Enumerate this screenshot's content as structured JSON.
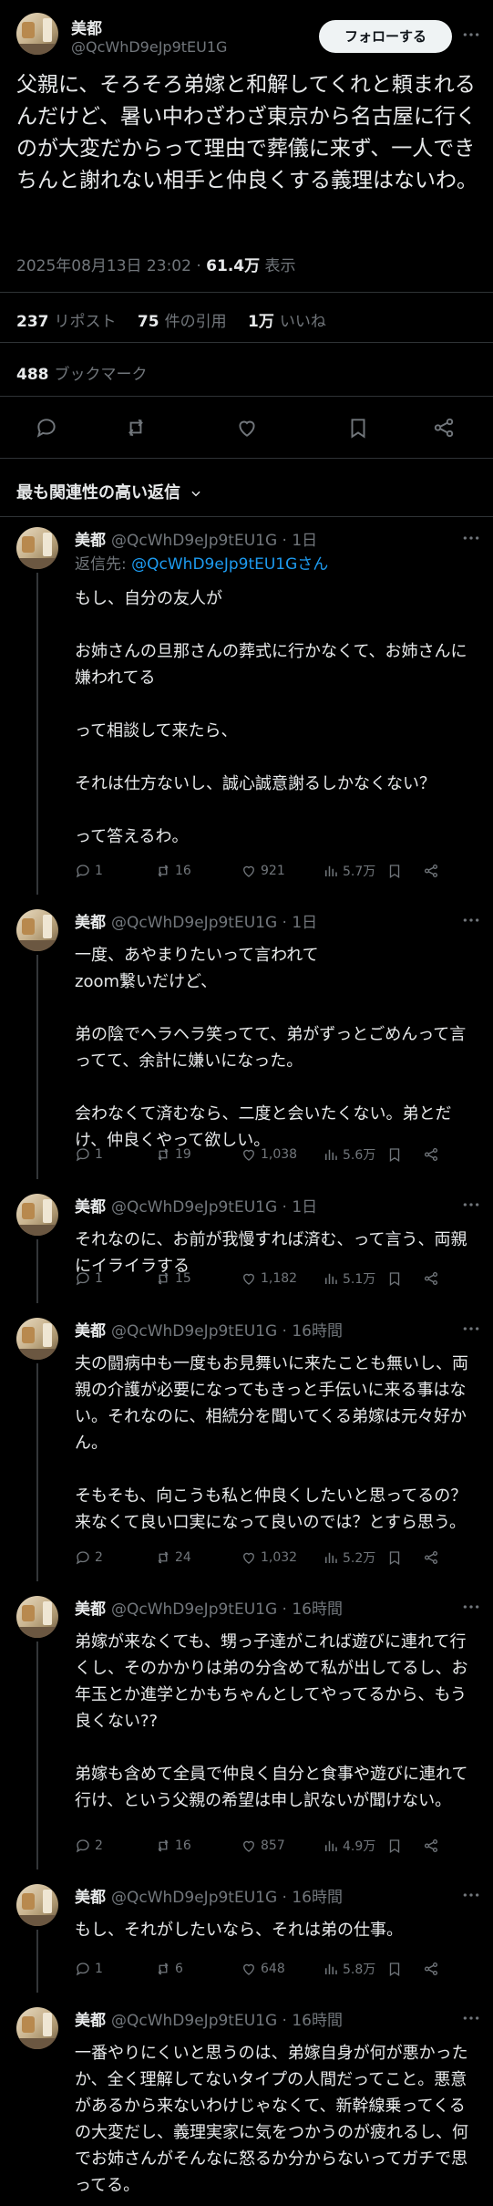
{
  "main": {
    "author_name": "美都",
    "author_handle": "@QcWhD9eJp9tEU1G",
    "follow_label": "フォローする",
    "text": "父親に、そろそろ弟嫁と和解してくれと頼まれるんだけど、暑い中わざわざ東京から名古屋に行くのが大変だからって理由で葬儀に来ず、一人できちんと謝れない相手と仲良くする義理はないわ。",
    "timestamp": "2025年08月13日 23:02",
    "views_count": "61.4万",
    "views_label": "表示",
    "reposts_count": "237",
    "reposts_label": "リポスト",
    "quotes_count": "75",
    "quotes_label": "件の引用",
    "likes_count": "1万",
    "likes_label": "いいね",
    "bookmarks_count": "488",
    "bookmarks_label": "ブックマーク",
    "action_icons": [
      "reply-icon",
      "repost-icon",
      "like-icon",
      "bookmark-icon",
      "share-icon"
    ]
  },
  "sort_label": "最も関連性の高い返信",
  "replies": [
    {
      "name": "美都",
      "handle": "@QcWhD9eJp9tEU1G",
      "time": "1日",
      "replyto_prefix": "返信先: ",
      "replyto_handle": "@QcWhD9eJp9tEU1Gさん",
      "text": "もし、自分の友人が\n\nお姉さんの旦那さんの葬式に行かなくて、お姉さんに嫌われてる\n\nって相談して来たら、\n\nそれは仕方ないし、誠心誠意謝るしかなくない？\n\nって答えるわ。",
      "replies": "1",
      "reposts": "16",
      "likes": "921",
      "views": "5.7万"
    },
    {
      "name": "美都",
      "handle": "@QcWhD9eJp9tEU1G",
      "time": "1日",
      "text": "一度、あやまりたいって言われて\nzoom繋いだけど、\n\n弟の陰でヘラヘラ笑ってて、弟がずっとごめんって言ってて、余計に嫌いになった。\n\n会わなくて済むなら、二度と会いたくない。弟とだけ、仲良くやって欲しい。",
      "replies": "1",
      "reposts": "19",
      "likes": "1,038",
      "views": "5.6万"
    },
    {
      "name": "美都",
      "handle": "@QcWhD9eJp9tEU1G",
      "time": "1日",
      "text": "それなのに、お前が我慢すれば済む、って言う、両親にイライラする",
      "replies": "1",
      "reposts": "15",
      "likes": "1,182",
      "views": "5.1万"
    },
    {
      "name": "美都",
      "handle": "@QcWhD9eJp9tEU1G",
      "time": "16時間",
      "text": "夫の闘病中も一度もお見舞いに来たことも無いし、両親の介護が必要になってもきっと手伝いに来る事はない。それなのに、相続分を聞いてくる弟嫁は元々好かん。\n\nそもそも、向こうも私と仲良くしたいと思ってるの？\n来なくて良い口実になって良いのでは？とすら思う。",
      "replies": "2",
      "reposts": "24",
      "likes": "1,032",
      "views": "5.2万"
    },
    {
      "name": "美都",
      "handle": "@QcWhD9eJp9tEU1G",
      "time": "16時間",
      "text": "弟嫁が来なくても、甥っ子達がこれば遊びに連れて行くし、そのかかりは弟の分含めて私が出してるし、お年玉とか進学とかもちゃんとしてやってるから、もう良くない??\n\n弟嫁も含めて全員で仲良く自分と食事や遊びに連れて行け、という父親の希望は申し訳ないが聞けない。",
      "replies": "2",
      "reposts": "16",
      "likes": "857",
      "views": "4.9万"
    },
    {
      "name": "美都",
      "handle": "@QcWhD9eJp9tEU1G",
      "time": "16時間",
      "text": "もし、それがしたいなら、それは弟の仕事。",
      "replies": "1",
      "reposts": "6",
      "likes": "648",
      "views": "5.8万"
    },
    {
      "name": "美都",
      "handle": "@QcWhD9eJp9tEU1G",
      "time": "16時間",
      "text": "一番やりにくいと思うのは、弟嫁自身が何が悪かったか、全く理解してないタイプの人間だってこと。悪意があるから来ないわけじゃなくて、新幹線乗ってくるの大変だし、義理実家に気をつかうのが疲れるし、何でお姉さんがそんなに怒るか分からないってガチで思ってる。",
      "replies": "",
      "reposts": "",
      "likes": "",
      "views": ""
    }
  ],
  "colors": {
    "background": "#000000",
    "text_primary": "#e7e9ea",
    "text_secondary": "#71767b",
    "link": "#1d9bf0",
    "divider": "#2f3336"
  }
}
